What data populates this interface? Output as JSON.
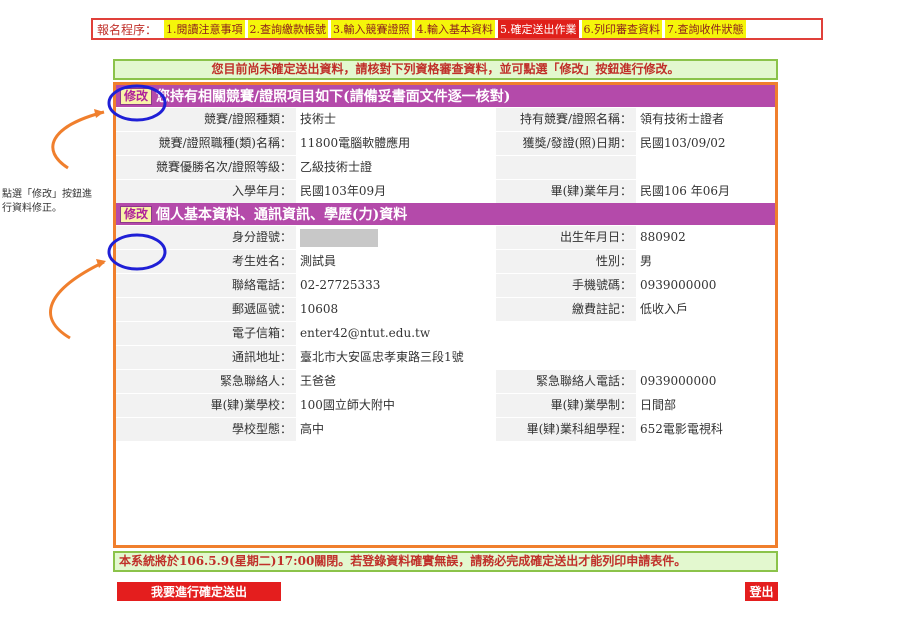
{
  "steps": {
    "lead": "報名程序：",
    "items": [
      "1.閱讀注意事項",
      "2.查詢繳款帳號",
      "3.輸入競賽證照",
      "4.輸入基本資料",
      "5.確定送出作業",
      "6.列印審查資料",
      "7.查詢收件狀態"
    ]
  },
  "notice": "您目前尚未確定送出資料，請核對下列資格審查資料，並可點選「修改」按鈕進行修改。",
  "edit_label": "修改",
  "side_note": "點選「修改」按鈕進行資料修正。",
  "section1": {
    "title": "您持有相關競賽/證照項目如下(請備妥書面文件逐一核對)",
    "rows": [
      {
        "l1": "競賽/證照種類：",
        "v1": "技術士",
        "l2": "持有競賽/證照名稱：",
        "v2": "領有技術士證者"
      },
      {
        "l1": "競賽/證照職種(類)名稱：",
        "v1": "11800電腦軟體應用",
        "l2": "獲獎/發證(照)日期：",
        "v2": "民國103/09/02"
      },
      {
        "l1": "競賽優勝名次/證照等級：",
        "v1": "乙級技術士證",
        "l2": "",
        "v2": ""
      },
      {
        "l1": "入學年月：",
        "v1": "民國103年09月",
        "l2": "畢(肄)業年月：",
        "v2": "民國106 年06月"
      }
    ]
  },
  "section2": {
    "title": "個人基本資料、通訊資訊、學歷(力)資料",
    "id_label": "身分證號：",
    "birth_label": "出生年月日：",
    "birth": "880902",
    "rows": [
      {
        "l1": "考生姓名：",
        "v1": "測試員",
        "l2": "性別：",
        "v2": "男"
      },
      {
        "l1": "聯絡電話：",
        "v1": "02-27725333",
        "l2": "手機號碼：",
        "v2": "0939000000"
      },
      {
        "l1": "郵遞區號：",
        "v1": "10608",
        "l2": "繳費註記：",
        "v2": "低收入戶"
      }
    ],
    "email_label": "電子信箱：",
    "email": "enter42@ntut.edu.tw",
    "addr_label": "通訊地址：",
    "addr": "臺北市大安區忠孝東路三段1號",
    "rows2": [
      {
        "l1": "緊急聯絡人：",
        "v1": "王爸爸",
        "l2": "緊急聯絡人電話：",
        "v2": "0939000000"
      },
      {
        "l1": "畢(肄)業學校：",
        "v1": "100國立師大附中",
        "l2": "畢(肄)業學制：",
        "v2": "日間部"
      },
      {
        "l1": "學校型態：",
        "v1": "高中",
        "l2": "畢(肄)業科組學程：",
        "v2": "652電影電視科"
      }
    ]
  },
  "bottom_notice": "本系統將於106.5.9(星期二)17:00關閉。若登錄資料確實無誤，請務必完成確定送出才能列印申請表件。",
  "buttons": {
    "confirm": "我要進行確定送出",
    "logout": "登出"
  },
  "colors": {
    "section": "#b44aaa",
    "frame": "#f07f2d",
    "highlight": "#1f1fd6",
    "notice_bg": "#e3f8cf"
  }
}
